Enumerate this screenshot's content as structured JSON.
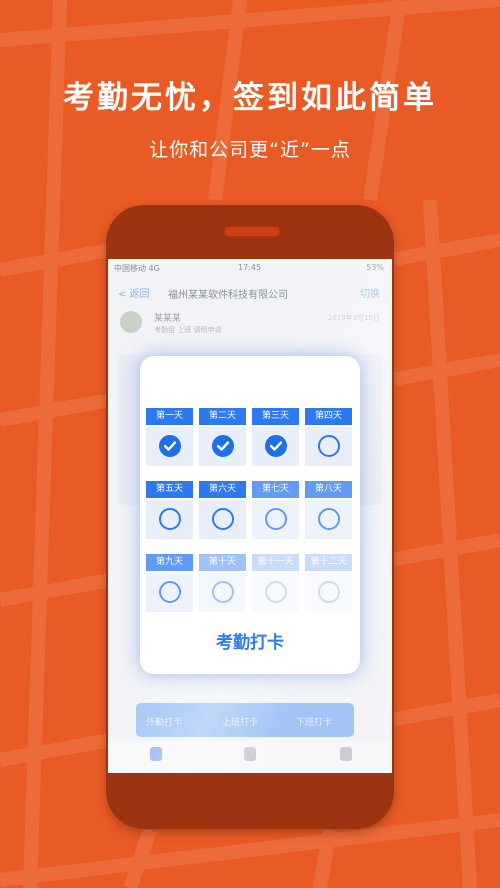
{
  "headline": "考勤无忧，签到如此简单",
  "subline": "让你和公司更“近”一点",
  "screen": {
    "status_left": "中国移动 4G",
    "status_time": "17:45",
    "status_right": "53%",
    "nav_back": "< 返回",
    "nav_title": "福州某某软件科技有限公司",
    "nav_right": "切换",
    "profile_name": "某某某",
    "profile_sub": "考勤组 上班    请假申请",
    "profile_date": "2019年3月15日",
    "bottom_left": "外勤打卡",
    "bottom_mid": "上班打卡",
    "bottom_right": "下班打卡"
  },
  "card": {
    "title": "考勤打卡",
    "days": [
      {
        "label": "第一天",
        "checked": true
      },
      {
        "label": "第二天",
        "checked": true
      },
      {
        "label": "第三天",
        "checked": true
      },
      {
        "label": "第四天",
        "checked": false
      },
      {
        "label": "第五天",
        "checked": false
      },
      {
        "label": "第六天",
        "checked": false
      },
      {
        "label": "第七天",
        "checked": false
      },
      {
        "label": "第八天",
        "checked": false
      },
      {
        "label": "第九天",
        "checked": false
      },
      {
        "label": "第十天",
        "checked": false
      },
      {
        "label": "第十一天",
        "checked": false
      },
      {
        "label": "第十二天",
        "checked": false
      }
    ]
  },
  "colors": {
    "background": "#ea5a24",
    "phone_body": "#9c3412",
    "accent_blue": "#2d7af0"
  }
}
